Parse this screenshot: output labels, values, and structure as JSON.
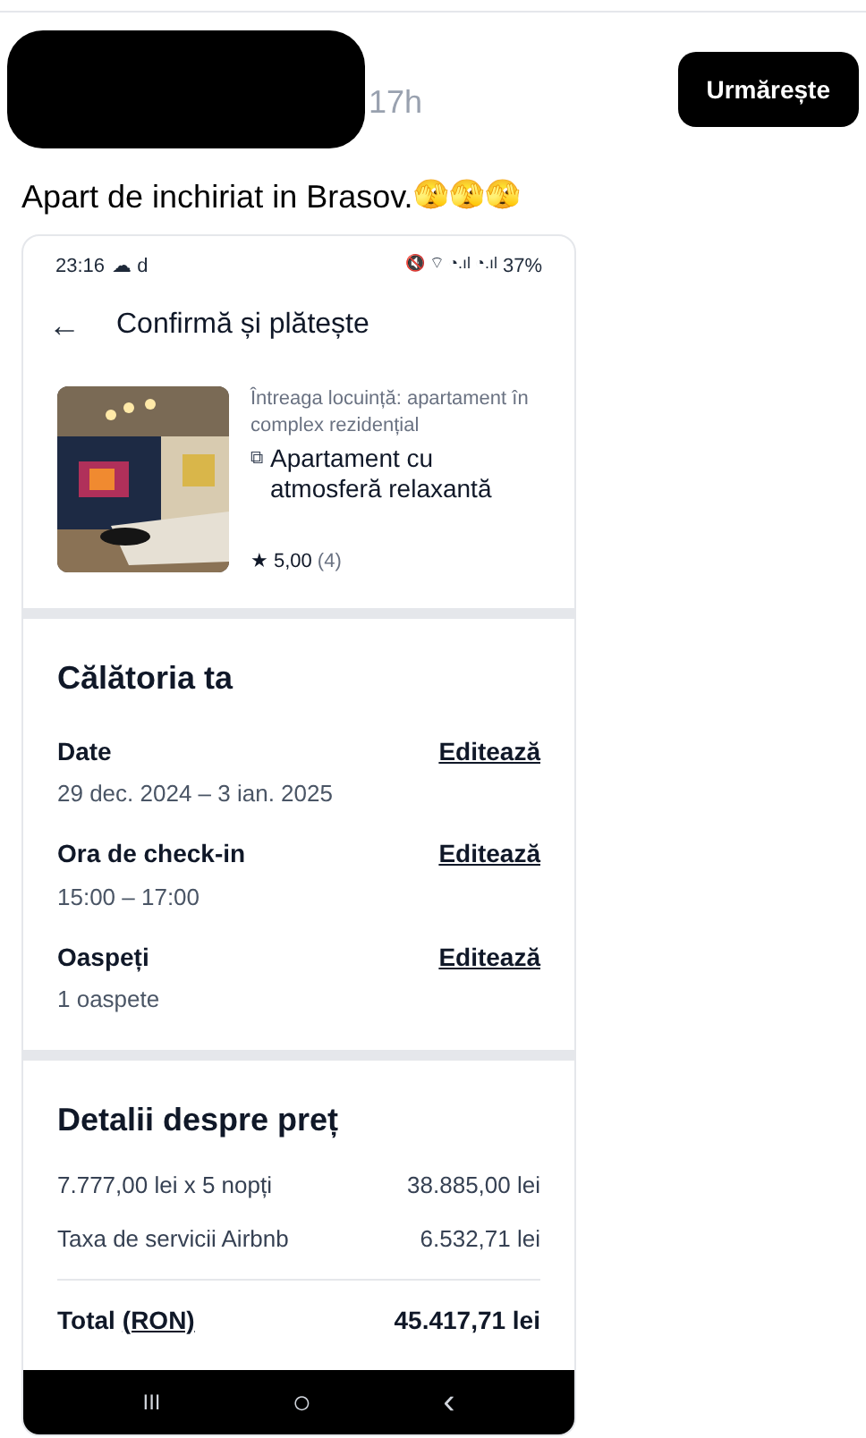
{
  "post": {
    "time": "17h",
    "follow_button": "Urmărește",
    "caption": "Apart de inchiriat in Brasov.",
    "emoji": [
      "🫣",
      "🫣",
      "🫣"
    ]
  },
  "phone": {
    "status_bar": {
      "time": "23:16",
      "left_icons": "☁ d",
      "right_icons": "🔇 ⌔ ◔.ıl ◔.ıl",
      "battery": "37%"
    },
    "header": {
      "back": "←",
      "title": "Confirmă și plătește"
    },
    "listing": {
      "type": "Întreaga locuință: apartament în complex rezidențial",
      "name_icon": "⧉",
      "name": "Apartament cu atmosferă relaxantă",
      "star": "★",
      "rating": "5,00",
      "reviews": "(4)"
    },
    "trip": {
      "title": "Călătoria ta",
      "items": [
        {
          "label": "Date",
          "value": "29 dec. 2024 – 3 ian. 2025",
          "action": "Editează"
        },
        {
          "label": "Ora de check-in",
          "value": "15:00 – 17:00",
          "action": "Editează"
        },
        {
          "label": "Oaspeți",
          "value": "1 oaspete",
          "action": "Editează"
        }
      ]
    },
    "price": {
      "title": "Detalii despre preț",
      "rows": [
        {
          "label": "7.777,00 lei x 5 nopți",
          "amount": "38.885,00 lei"
        },
        {
          "label": "Taxa de servicii Airbnb",
          "amount": "6.532,71 lei"
        }
      ],
      "total_label": "Total",
      "total_currency": "(RON)",
      "total_amount": "45.417,71 lei"
    },
    "nav_bar": {
      "recents": "III",
      "home": "○",
      "back": "‹"
    }
  }
}
